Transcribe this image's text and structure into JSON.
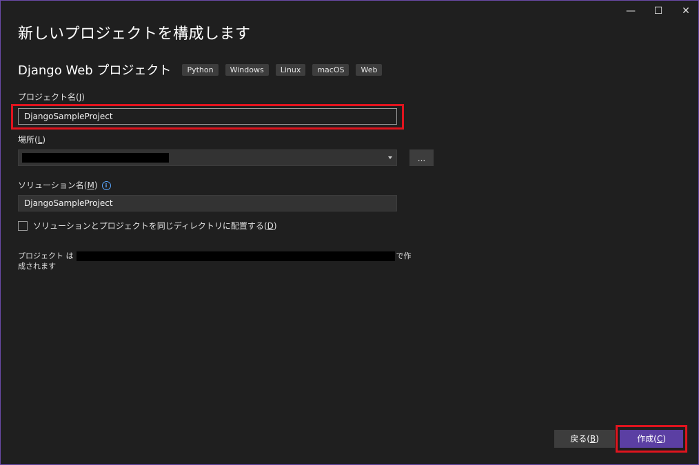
{
  "window": {
    "title": "新しいプロジェクトを構成します",
    "controls": {
      "minimize": "—",
      "maximize": "☐",
      "close": "✕"
    },
    "accent_color": "#6a4aa8"
  },
  "template": {
    "name": "Django Web プロジェクト",
    "tags": [
      "Python",
      "Windows",
      "Linux",
      "macOS",
      "Web"
    ]
  },
  "project_name": {
    "label": "プロジェクト名",
    "mnemonic": "J",
    "value": "DjangoSampleProject"
  },
  "location": {
    "label": "場所",
    "mnemonic": "L",
    "value": "",
    "browse_label": "..."
  },
  "solution_name": {
    "label": "ソリューション名",
    "mnemonic": "M",
    "value": "DjangoSampleProject",
    "info_icon": "ⓘ"
  },
  "same_directory": {
    "label": "ソリューションとプロジェクトを同じディレクトリに配置する",
    "mnemonic": "D",
    "checked": false
  },
  "path_note": {
    "prefix": "プロジェクト は",
    "suffix_line1": "で作",
    "line2": "成されます"
  },
  "buttons": {
    "back": {
      "label": "戻る",
      "mnemonic": "B"
    },
    "create": {
      "label": "作成",
      "mnemonic": "C",
      "color": "#5b3fa3"
    }
  },
  "highlight_color": "#e0141e"
}
